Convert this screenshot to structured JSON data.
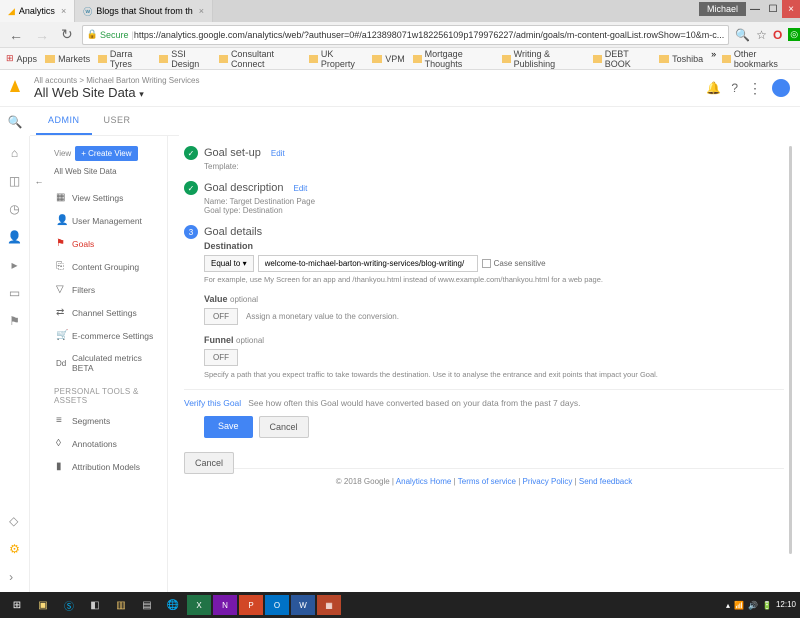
{
  "browser": {
    "tabs": [
      {
        "title": "Analytics",
        "active": true
      },
      {
        "title": "Blogs that Shout from th",
        "active": false
      }
    ],
    "user_badge": "Michael",
    "secure_label": "Secure",
    "url": "https://analytics.google.com/analytics/web/?authuser=0#/a123898071w182256109p179976227/admin/goals/m-content-goalList.rowShow=10&m-c...",
    "bookmarks": {
      "apps": "Apps",
      "items": [
        "Markets",
        "Darra Tyres",
        "SSI Design",
        "Consultant Connect",
        "UK Property",
        "VPM",
        "Mortgage Thoughts",
        "Writing & Publishing",
        "DEBT BOOK",
        "Toshiba"
      ],
      "other": "Other bookmarks"
    }
  },
  "ga": {
    "breadcrumb": "All accounts > Michael Barton Writing Services",
    "view_title": "All Web Site Data",
    "tabs": {
      "admin": "ADMIN",
      "user": "USER"
    }
  },
  "admin_col": {
    "view_label": "View",
    "create_view": "+  Create View",
    "all_data": "All Web Site Data",
    "items": [
      {
        "icon": "▦",
        "label": "View Settings"
      },
      {
        "icon": "👤",
        "label": "User Management"
      },
      {
        "icon": "⚑",
        "label": "Goals",
        "active": true
      },
      {
        "icon": "⎘",
        "label": "Content Grouping"
      },
      {
        "icon": "▽",
        "label": "Filters"
      },
      {
        "icon": "⇄",
        "label": "Channel Settings"
      },
      {
        "icon": "🛒",
        "label": "E-commerce Settings"
      },
      {
        "icon": "Dd",
        "label": "Calculated metrics BETA"
      }
    ],
    "personal_header": "PERSONAL TOOLS & ASSETS",
    "personal": [
      {
        "icon": "≡",
        "label": "Segments"
      },
      {
        "icon": "◊",
        "label": "Annotations"
      },
      {
        "icon": "▮",
        "label": "Attribution Models"
      }
    ]
  },
  "goal": {
    "step1": {
      "title": "Goal set-up",
      "edit": "Edit",
      "sub": "Template:"
    },
    "step2": {
      "title": "Goal description",
      "edit": "Edit",
      "name": "Name: Target Destination Page",
      "type": "Goal type: Destination"
    },
    "step3": {
      "title": "Goal details"
    },
    "destination": {
      "label": "Destination",
      "match": "Equal to",
      "value": "welcome-to-michael-barton-writing-services/blog-writing/",
      "case_sensitive": "Case sensitive",
      "hint": "For example, use My Screen for an app and /thankyou.html instead of www.example.com/thankyou.html for a web page."
    },
    "value": {
      "label": "Value",
      "optional": "optional",
      "toggle": "OFF",
      "side": "Assign a monetary value to the conversion."
    },
    "funnel": {
      "label": "Funnel",
      "optional": "optional",
      "toggle": "OFF",
      "hint": "Specify a path that you expect traffic to take towards the destination. Use it to analyse the entrance and exit points that impact your Goal."
    },
    "verify": {
      "link": "Verify this Goal",
      "text": "See how often this Goal would have converted based on your data from the past 7 days."
    },
    "save": "Save",
    "cancel": "Cancel"
  },
  "footer": {
    "copyright": "© 2018 Google",
    "links": [
      "Analytics Home",
      "Terms of service",
      "Privacy Policy",
      "Send feedback"
    ]
  },
  "taskbar": {
    "time": "12:10"
  }
}
